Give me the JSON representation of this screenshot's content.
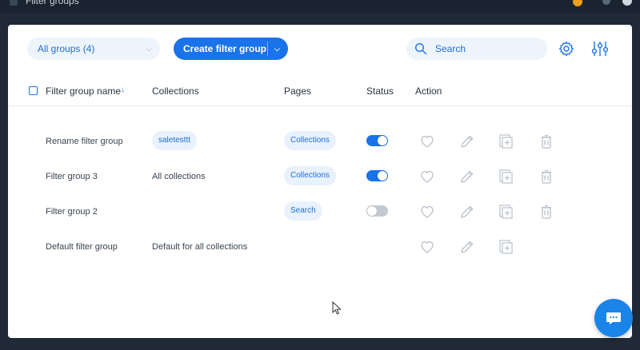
{
  "window": {
    "title": "Filter groups"
  },
  "toolbar": {
    "groups_select_label": "All groups (4)",
    "create_button_label": "Create filter group",
    "search_placeholder": "Search"
  },
  "table": {
    "columns": [
      "Filter group name",
      "Collections",
      "Pages",
      "Status",
      "Action"
    ],
    "rows": [
      {
        "name": "Rename filter group",
        "collection": "saletesttt",
        "collection_is_chip": true,
        "page": "Collections",
        "status": "on"
      },
      {
        "name": "Filter group 3",
        "collection": "All collections",
        "collection_is_chip": false,
        "page": "Collections",
        "status": "on"
      },
      {
        "name": "Filter group 2",
        "collection": "",
        "collection_is_chip": false,
        "page": "Search",
        "status": "off"
      },
      {
        "name": "Default filter group",
        "collection": "Default for all collections",
        "collection_is_chip": false,
        "page": "",
        "status": "none"
      }
    ]
  },
  "colors": {
    "accent": "#1a73e8",
    "chip_bg": "#e8f1fc",
    "toggle_off": "#c3c9d0",
    "panel_bg": "#ffffff",
    "page_bg": "#1f2a36"
  },
  "icons": [
    "search-icon",
    "gear-icon",
    "sliders-icon",
    "sort-down-icon",
    "heart-icon",
    "pencil-icon",
    "duplicate-icon",
    "trash-icon",
    "chat-icon",
    "chevron-down-icon"
  ]
}
